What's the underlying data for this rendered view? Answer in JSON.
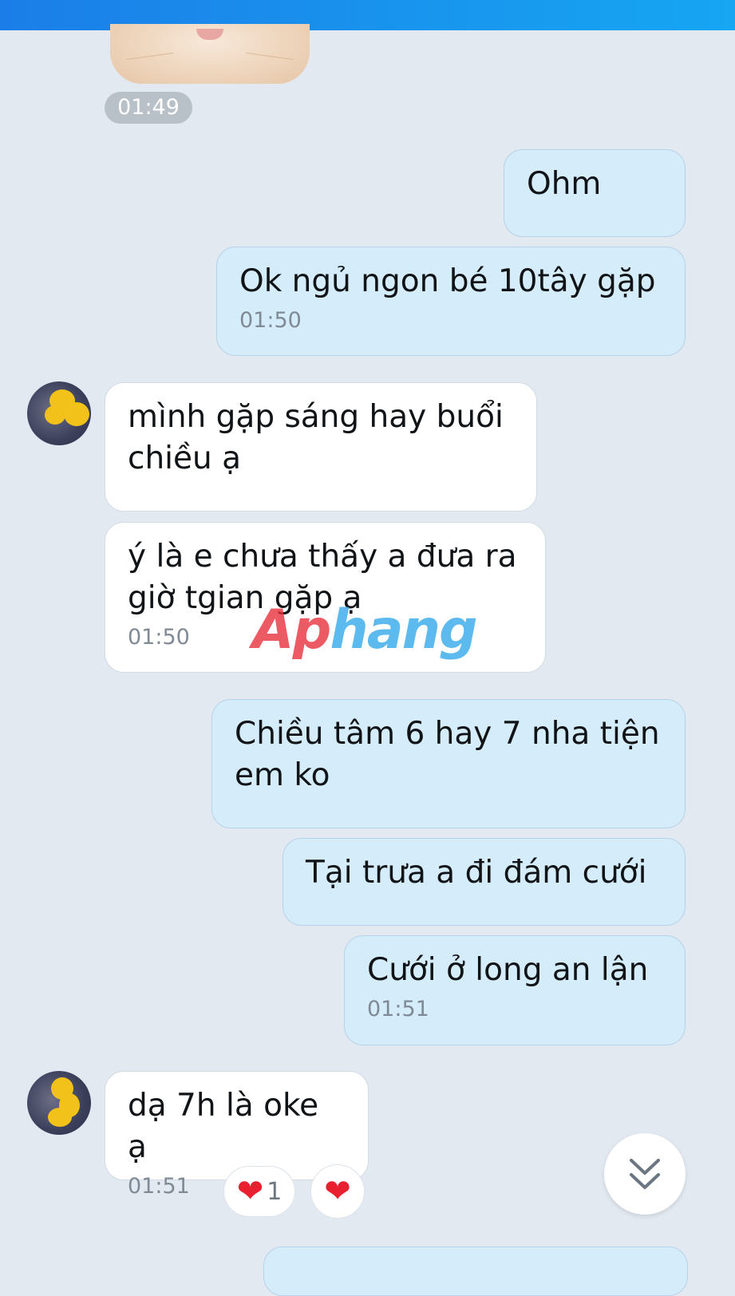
{
  "header": {
    "bar_color": "#1b7ee8"
  },
  "sticker": {
    "time": "01:49",
    "icon": "cat-sticker-icon"
  },
  "messages": [
    {
      "side": "out",
      "text": "Ohm",
      "time": ""
    },
    {
      "side": "out",
      "text": "Ok ngủ ngon bé 10tây gặp",
      "time": "01:50"
    },
    {
      "side": "in",
      "text": "mình gặp sáng hay buổi\nchiều ạ",
      "time": ""
    },
    {
      "side": "in",
      "text": "ý là e chưa thấy a đưa ra\ngiờ tgian gặp ạ",
      "time": "01:50"
    },
    {
      "side": "out",
      "text": "Chiều tâm 6 hay 7 nha tiện\nem ko",
      "time": ""
    },
    {
      "side": "out",
      "text": "Tại trưa a đi đám cưới",
      "time": ""
    },
    {
      "side": "out",
      "text": "Cưới ở long an lận",
      "time": "01:51"
    },
    {
      "side": "in",
      "text": "dạ 7h là oke ạ",
      "time": "01:51"
    }
  ],
  "reactions": [
    {
      "icon": "heart-icon",
      "count": "1"
    },
    {
      "icon": "heart-icon",
      "count": ""
    }
  ],
  "watermark": {
    "part1": "Ap",
    "part2": "hang"
  },
  "colors": {
    "background": "#e2e9f1",
    "outgoing_bubble": "#d5ecfb",
    "incoming_bubble": "#ffffff",
    "heart": "#e8202f"
  }
}
